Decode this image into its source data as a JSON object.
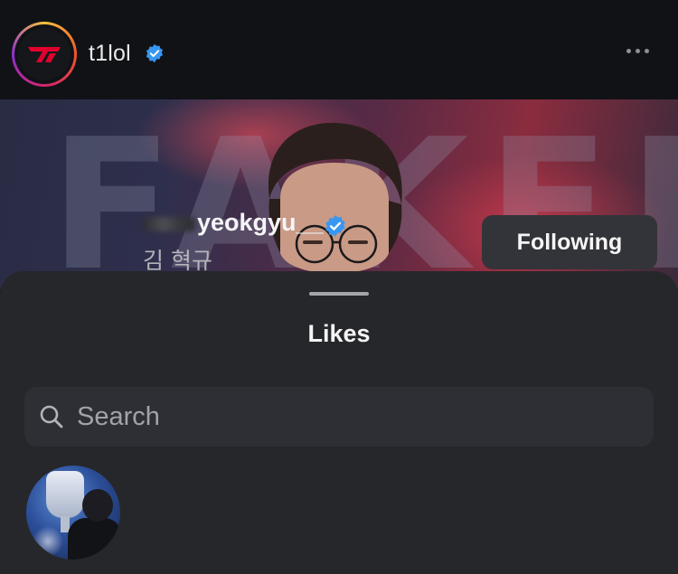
{
  "post": {
    "username": "t1lol",
    "image_text": "FAKER"
  },
  "likes_sheet": {
    "title": "Likes",
    "search": {
      "placeholder": "Search",
      "value": ""
    },
    "users": [
      {
        "username": "yeokgyu__",
        "full_name": "김 혁규",
        "verified": true,
        "button_label": "Following"
      }
    ]
  },
  "colors": {
    "verified_badge": "#3897f0",
    "sheet_background": "#26272b",
    "brand_red": "#e2012d"
  },
  "icons": [
    "t1-logo-icon",
    "verified-icon",
    "more-icon",
    "search-icon"
  ]
}
